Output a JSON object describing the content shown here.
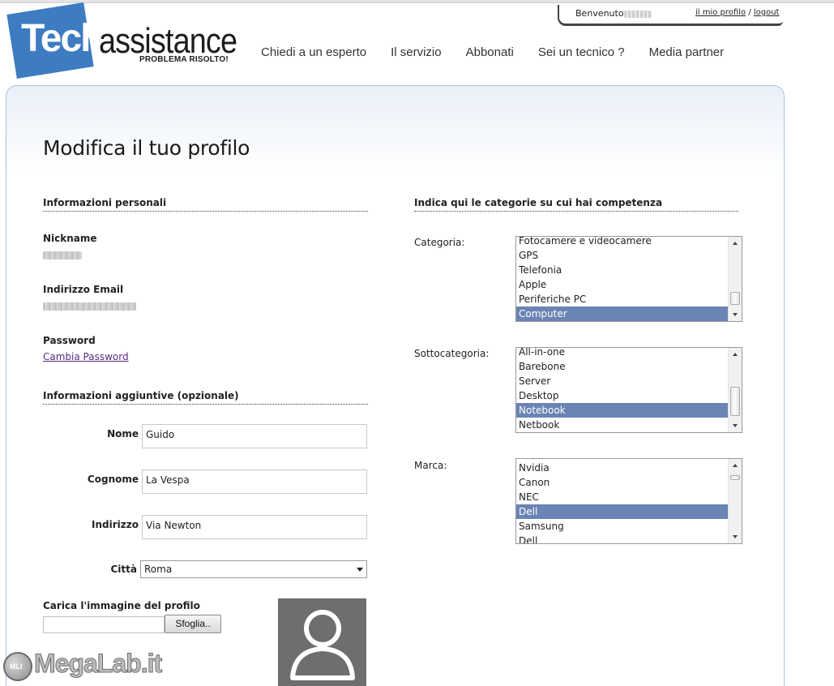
{
  "logo": {
    "tech": "Tech",
    "assistance": "assistance",
    "tagline": "PROBLEMA RISOLTO!"
  },
  "userbar": {
    "welcome": "Benvenuto",
    "profile_link": "il mio profilo",
    "separator": "/",
    "logout_link": "logout"
  },
  "nav": {
    "items": [
      "Chiedi a un esperto",
      "Il servizio",
      "Abbonati",
      "Sei un tecnico ?",
      "Media partner"
    ]
  },
  "page": {
    "title": "Modifica il tuo profilo"
  },
  "personal": {
    "heading": "Informazioni personali",
    "nickname_label": "Nickname",
    "email_label": "Indirizzo Email",
    "password_label": "Password",
    "change_password_link": "Cambia Password"
  },
  "additional": {
    "heading": "Informazioni aggiuntive (opzionale)",
    "nome_label": "Nome",
    "nome_value": "Guido",
    "cognome_label": "Cognome",
    "cognome_value": "La Vespa",
    "indirizzo_label": "Indirizzo",
    "indirizzo_value": "Via Newton",
    "citta_label": "Città",
    "citta_value": "Roma",
    "upload_label": "Carica l'immagine del profilo",
    "browse_button": "Sfoglia.."
  },
  "competence": {
    "heading": "Indica qui le categorie su cui hai competenza",
    "categoria_label": "Categoria:",
    "categoria_options": [
      "Fotocamere e videocamere",
      "GPS",
      "Telefonia",
      "Apple",
      "Periferiche PC",
      "Computer"
    ],
    "categoria_selected": "Computer",
    "sottocategoria_label": "Sottocategoria:",
    "sottocategoria_options": [
      "All-in-one",
      "Barebone",
      "Server",
      "Desktop",
      "Notebook",
      "Netbook"
    ],
    "sottocategoria_selected": "Notebook",
    "marca_label": "Marca:",
    "marca_options": [
      "Nvidia",
      "Canon",
      "NEC",
      "Dell",
      "Samsung",
      "Dell"
    ],
    "marca_selected_index": 3
  },
  "watermark": {
    "text": "MegaLab.it",
    "badge": "MLI"
  },
  "colors": {
    "brand_blue": "#3d7cc0",
    "selection": "#6a84b4",
    "panel_border": "#a9c1dd"
  }
}
